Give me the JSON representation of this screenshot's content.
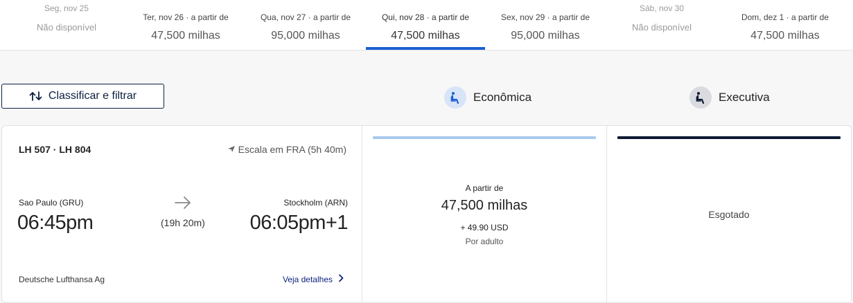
{
  "date_tabs": [
    {
      "label": "Seg, nov 25",
      "price": "Não disponível",
      "available": false,
      "active": false
    },
    {
      "label": "Ter, nov 26 · a partir de",
      "price": "47,500 milhas",
      "available": true,
      "active": false
    },
    {
      "label": "Qua, nov 27 · a partir de",
      "price": "95,000 milhas",
      "available": true,
      "active": false
    },
    {
      "label": "Qui, nov 28 · a partir de",
      "price": "47,500 milhas",
      "available": true,
      "active": true
    },
    {
      "label": "Sex, nov 29 · a partir de",
      "price": "95,000 milhas",
      "available": true,
      "active": false
    },
    {
      "label": "Sáb, nov 30",
      "price": "Não disponível",
      "available": false,
      "active": false
    },
    {
      "label": "Dom, dez 1 · a partir de",
      "price": "47,500 milhas",
      "available": true,
      "active": false
    }
  ],
  "toolbar": {
    "sort_filter_label": "Classificar e filtrar",
    "sort_icon": "sort-arrows-icon"
  },
  "cabins": {
    "economy": {
      "label": "Econômica",
      "icon": "seat-icon",
      "accent": "#1a5fd4"
    },
    "business": {
      "label": "Executiva",
      "icon": "seat-icon",
      "accent": "#0d1a33"
    }
  },
  "flight": {
    "numbers": "LH 507 · LH 804",
    "stop": "Escala em FRA (5h 40m)",
    "origin": {
      "code": "Sao Paulo (GRU)",
      "time": "06:45pm"
    },
    "destination": {
      "code": "Stockholm (ARN)",
      "time": "06:05pm+1"
    },
    "duration": "(19h 20m)",
    "carrier": "Deutsche Lufthansa Ag",
    "details_link": "Veja detalhes"
  },
  "fares": {
    "economy": {
      "from_label": "A partir de",
      "price": "47,500 milhas",
      "taxes": "+ 49.90 USD",
      "per": "Por adulto"
    },
    "business": {
      "status": "Esgotado"
    }
  },
  "colors": {
    "active_tab": "#1a5fd4",
    "economy_bar": "#a9c9ee",
    "business_bar": "#0d1a33",
    "link": "#0b1f7a"
  }
}
